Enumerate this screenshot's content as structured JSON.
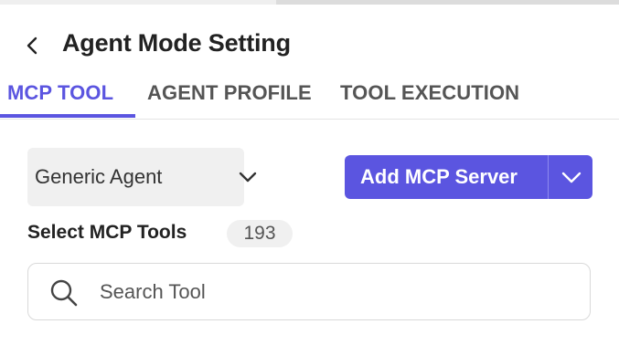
{
  "header": {
    "title": "Agent Mode Setting"
  },
  "tabs": [
    {
      "label": "MCP TOOL",
      "active": true
    },
    {
      "label": "AGENT PROFILE",
      "active": false
    },
    {
      "label": "TOOL EXECUTION",
      "active": false
    }
  ],
  "agent_select": {
    "value": "Generic Agent"
  },
  "add_server": {
    "label": "Add MCP Server"
  },
  "tools": {
    "label": "Select MCP Tools",
    "count": "193"
  },
  "search": {
    "placeholder": "Search Tool"
  },
  "colors": {
    "accent": "#5b55e0",
    "control_bg": "#f0f0f0",
    "border": "#d9d9d9"
  },
  "icons": [
    "chevron-left-icon",
    "chevron-down-icon",
    "search-icon"
  ]
}
